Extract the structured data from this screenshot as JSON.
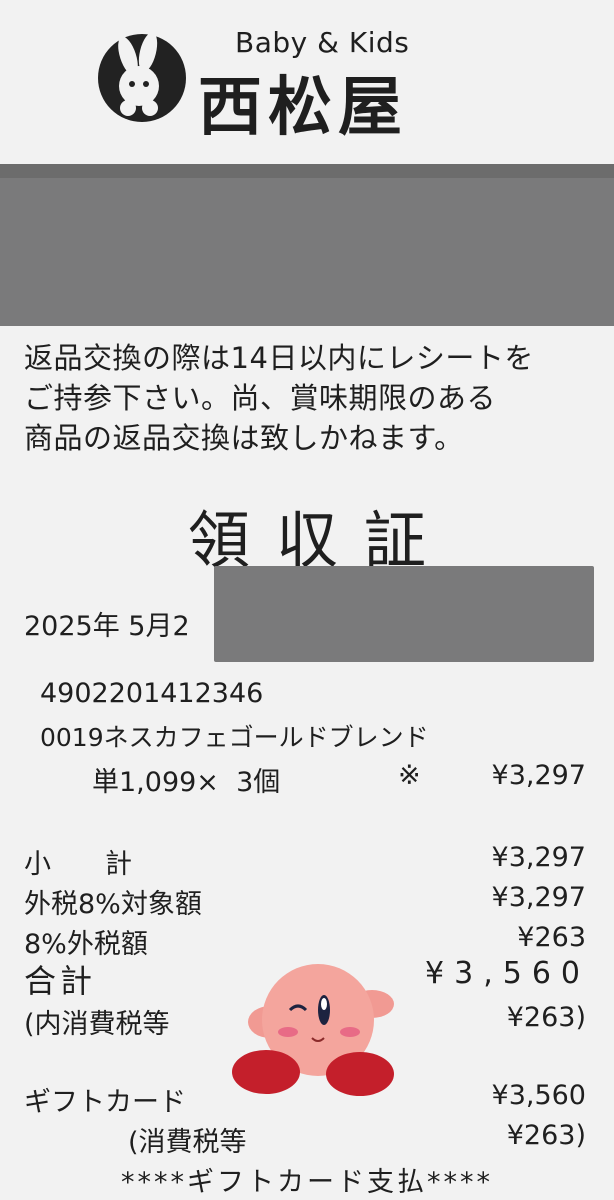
{
  "header": {
    "logo_sub": "Baby & Kids",
    "logo_name": "西松屋"
  },
  "notice": {
    "lines": [
      "返品交換の際は14日以内にレシートを",
      "ご持参下さい。尚、賞味期限のある",
      "商品の返品交換は致しかねます。"
    ]
  },
  "title": "領収証",
  "date_partial": "2025年 5月2",
  "item": {
    "jan": "4902201412346",
    "name": "0019ネスカフェゴールドブレンド",
    "quantity_line": "単1,099×  3個",
    "mark": "※",
    "amount": "¥3,297"
  },
  "summary": [
    {
      "label": "小　　計",
      "amount": "¥3,297"
    },
    {
      "label": "外税8%対象額",
      "amount": "¥3,297"
    },
    {
      "label": "8%外税額",
      "amount": "¥263"
    }
  ],
  "total": {
    "label": "合計",
    "amount": "¥3,560"
  },
  "tax_incl": {
    "label": "(内消費税等",
    "amount": "¥263)"
  },
  "payment": {
    "label": "ギフトカード",
    "amount": "¥3,560"
  },
  "payment_tax": {
    "label": "(消費税等",
    "amount": "¥263)"
  },
  "footer": "****ギフトカード支払****",
  "colors": {
    "paper": "#f2f2f2",
    "redaction": "#7a7a7b",
    "ink": "#1f1f1f",
    "sticker_body": "#f19a93",
    "sticker_feet": "#c41f2b"
  },
  "icons": {
    "logo": "rabbit-emblem-icon",
    "sticker": "kirby-sticker"
  }
}
